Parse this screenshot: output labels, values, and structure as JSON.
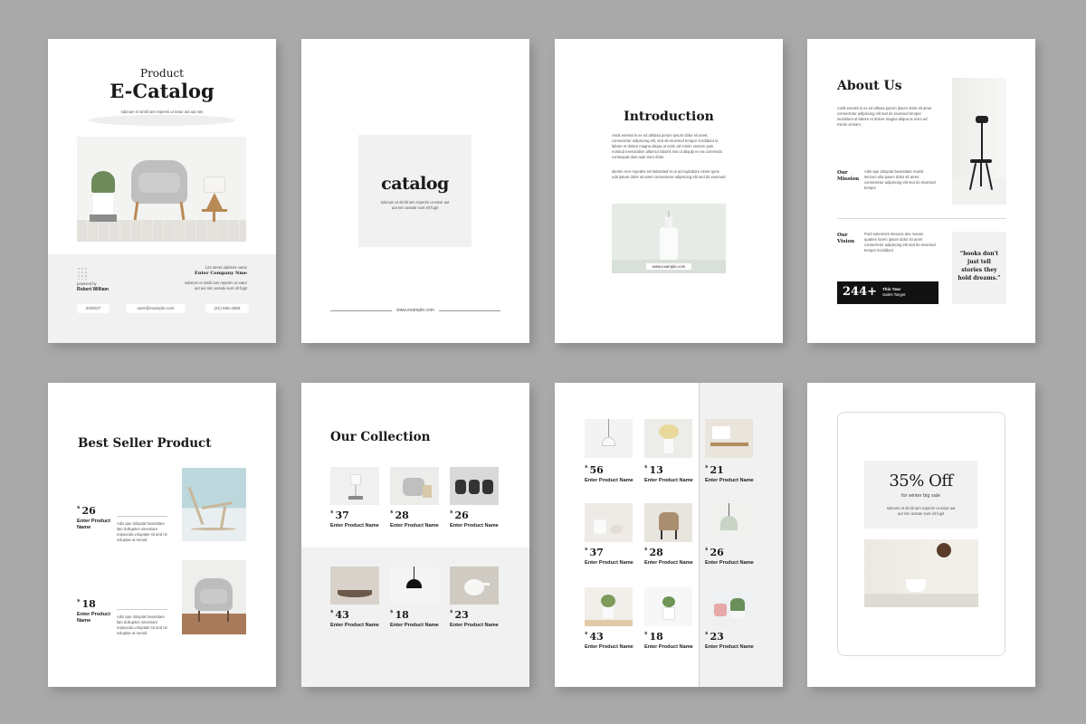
{
  "cover": {
    "subtitle": "Product",
    "title": "E-Catalog",
    "tagline": "sdonum et simlit iam reperim ut eatur aut aut nim aosate sunt elt fugit",
    "address": "123 street address name",
    "company": "Enter Company Nme",
    "company_desc": "sdonum et simlit iam reperim ut eatur aut aut nim aosate sunt elt fugit",
    "powered_by": "powered by",
    "author": "Robert William",
    "year": "2025/27",
    "email": "user@example.com",
    "phone": "(31) 555-3368"
  },
  "catalog_page": {
    "word": "catalog",
    "desc": "sdonum et simlit iam reperim ut eatur aut aut nim aosate sunt elt fugit",
    "url": "www.example.com"
  },
  "intro": {
    "title": "Introduction",
    "para1": "Andit exessit is ex ed atllutsa perum ipsum dolor sit amet, consectetur adipiscing elit, sed do eiusmod tempor incididunt ut labore et dolore magna aliqua ut enim ad minim veniam quis nostrud exercitation ullamco laboris nisi ut aliquip ex ea commodo consequat duis aute irure dolor",
    "para2": "alentm rere repedes eni Bdorated et ut ad explabore nimet quos uda ipsum dolor sit amet consectetur adipiscing elit sed do eiusmod",
    "url": "www.example.com"
  },
  "about": {
    "title": "About Us",
    "para": "Andit exessit is ex ed atllusa parum ipsum dolor sit amet consectetur adipiscing elit sed do eiusmod tempor incididunt ut labore et dolore magna aliqua ut enim ad minim veniam",
    "mission_label": "Our Mission",
    "mission_text": "Adis ape doluptat beassitare mamit secturo ulla ipsum dolor sit amet consectetur adipiscing elit sed do eiusmod tempor",
    "vision_label": "Our Vision",
    "vision_text": "Porit solerenim eleoces des nosam quatem lorem ipsum dolor sit amet consectetur adipiscing elit sed do eiusmod tempor incididunt",
    "stat_value": "244+",
    "stat_label_1": "This Year",
    "stat_label_2": "Sales Target",
    "quote": "“books don't just tell stories they hold dreams.”"
  },
  "bestseller": {
    "title": "Best Seller Product",
    "items": [
      {
        "currency": "$",
        "price": "26",
        "name": "Enter Product Name",
        "desc": "Adis ape doluptat beassitare lato dollupites nimeniare reipsuoda voluptate sit and nit voluptae at seraid"
      },
      {
        "currency": "$",
        "price": "18",
        "name": "Enter Product Name",
        "desc": "Adis ape doluptat beassitare lato dollupites nimeniare reipsuoda voluptate sit and nit voluptae at seraid"
      }
    ]
  },
  "collection": {
    "title": "Our Collection",
    "items": [
      {
        "currency": "$",
        "price": "37",
        "name": "Enter Product Name"
      },
      {
        "currency": "$",
        "price": "28",
        "name": "Enter Product Name"
      },
      {
        "currency": "$",
        "price": "26",
        "name": "Enter Product Name"
      },
      {
        "currency": "$",
        "price": "43",
        "name": "Enter Product Name"
      },
      {
        "currency": "$",
        "price": "18",
        "name": "Enter Product Name"
      },
      {
        "currency": "$",
        "price": "23",
        "name": "Enter Product Name"
      }
    ]
  },
  "grid": {
    "items": [
      {
        "currency": "$",
        "price": "56",
        "name": "Enter Product Name"
      },
      {
        "currency": "$",
        "price": "13",
        "name": "Enter Product Name"
      },
      {
        "currency": "$",
        "price": "21",
        "name": "Enter Product Name"
      },
      {
        "currency": "$",
        "price": "37",
        "name": "Enter Product Name"
      },
      {
        "currency": "$",
        "price": "28",
        "name": "Enter Product Name"
      },
      {
        "currency": "$",
        "price": "26",
        "name": "Enter Product Name"
      },
      {
        "currency": "$",
        "price": "43",
        "name": "Enter Product Name"
      },
      {
        "currency": "$",
        "price": "18",
        "name": "Enter Product Name"
      },
      {
        "currency": "$",
        "price": "23",
        "name": "Enter Product Name"
      }
    ]
  },
  "promo": {
    "headline": "35% Off",
    "sub": "for winter big sale",
    "desc": "sdonum et simlit iam reperim ut eatur aut aut nim aosate sunt elt fugit"
  },
  "colors": {
    "background": "#a9a9a9",
    "page": "#ffffff",
    "panel": "#f1f1f1",
    "ink": "#1a1a1a"
  }
}
